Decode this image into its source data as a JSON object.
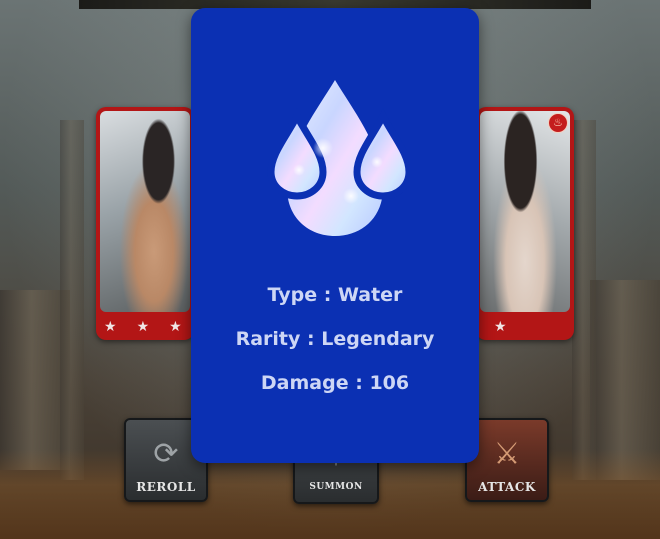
{
  "modal": {
    "element_icon": "water-drops-icon",
    "type_label": "Type",
    "type_value": "Water",
    "rarity_label": "Rarity",
    "rarity_value": "Legendary",
    "damage_label": "Damage",
    "damage_value": "106",
    "separator": ":",
    "background_color": "#0b30b3",
    "text_color": "#cdd6f5"
  },
  "cards": [
    {
      "position": "left",
      "rarity_stars": 3,
      "element_icon": "none"
    },
    {
      "position": "right",
      "rarity_stars": 1,
      "element_icon": "fire-icon"
    }
  ],
  "actions": {
    "reroll_label": "REROLL",
    "summon_label": "SUMMON",
    "attack_label": "ATTACK"
  }
}
